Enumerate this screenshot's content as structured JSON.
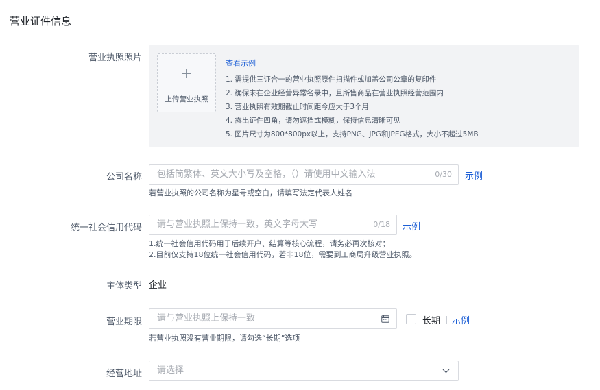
{
  "section": {
    "title": "营业证件信息"
  },
  "license_photo": {
    "label": "营业执照照片",
    "upload_plus": "+",
    "upload_text": "上传营业执照",
    "example_link": "查看示例",
    "notes": [
      "1. 需提供三证合一的营业执照原件扫描件或加盖公司公章的复印件",
      "2. 确保未在企业经营异常名录中，且所售商品在营业执照经营范围内",
      "3. 营业执照有效期截止时间距今应大于3个月",
      "4. 露出证件四角，请勿遮挡或模糊，保持信息清晰可见",
      "5. 图片尺寸为800*800px以上，支持PNG、JPG和JPEG格式，大小不超过5MB"
    ]
  },
  "company_name": {
    "label": "公司名称",
    "placeholder": "包括简繁体、英文大小写及空格，（）请使用中文输入法",
    "counter": "0/30",
    "example_link": "示例",
    "hint": "若营业执照的公司名称为星号或空白，请填写法定代表人姓名"
  },
  "credit_code": {
    "label": "统一社会信用代码",
    "placeholder": "请与营业执照上保持一致，英文字母大写",
    "counter": "0/18",
    "example_link": "示例",
    "hints": [
      "1.统一社会信用代码用于后续开户、结算等核心流程，请务必再次核对；",
      "2.目前仅支持18位统一社会信用代码，若非18位，需要到工商局升级营业执照。"
    ]
  },
  "entity_type": {
    "label": "主体类型",
    "value": "企业"
  },
  "business_term": {
    "label": "营业期限",
    "placeholder": "请与营业执照上保持一致",
    "long_term_label": "长期",
    "example_link": "示例",
    "hint": "若营业执照没有营业期限，请勾选“长期”选项"
  },
  "business_address": {
    "label": "经营地址",
    "placeholder": "请选择"
  },
  "colors": {
    "link": "#1d5fd6",
    "panel_bg": "#f2f3f5",
    "border": "#d9dbe0"
  }
}
